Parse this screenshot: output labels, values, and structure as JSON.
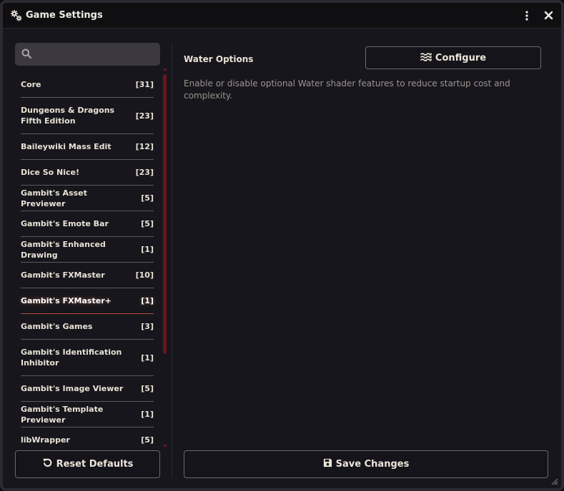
{
  "window": {
    "title": "Game Settings",
    "icons": {
      "title": "gears-icon",
      "menu": "kebab-menu-icon",
      "close": "close-icon"
    }
  },
  "sidebar": {
    "search": {
      "value": "",
      "placeholder": ""
    },
    "categories": [
      {
        "label": "Core",
        "count": "[31]"
      },
      {
        "label": "Dungeons & Dragons Fifth Edition",
        "count": "[23]"
      },
      {
        "label": "Baileywiki Mass Edit",
        "count": "[12]"
      },
      {
        "label": "Dice So Nice!",
        "count": "[23]"
      },
      {
        "label": "Gambit's Asset Previewer",
        "count": "[5]"
      },
      {
        "label": "Gambit's Emote Bar",
        "count": "[5]"
      },
      {
        "label": "Gambit's Enhanced Drawing",
        "count": "[1]"
      },
      {
        "label": "Gambit's FXMaster",
        "count": "[10]"
      },
      {
        "label": "Gambit's FXMaster+",
        "count": "[1]",
        "active": true
      },
      {
        "label": "Gambit's Games",
        "count": "[3]"
      },
      {
        "label": "Gambit's Identification Inhibitor",
        "count": "[1]"
      },
      {
        "label": "Gambit's Image Viewer",
        "count": "[5]"
      },
      {
        "label": "Gambit's Template Previewer",
        "count": "[1]"
      },
      {
        "label": "libWrapper",
        "count": "[5]"
      }
    ],
    "reset_label": "Reset Defaults"
  },
  "main": {
    "setting_name": "Water Options",
    "configure_label": "Configure",
    "setting_description": "Enable or disable optional Water shader features to reduce startup cost and complexity.",
    "save_label": "Save Changes"
  },
  "colors": {
    "accent": "#6b1420",
    "active_underline": "#b84a3a",
    "background": "#17161c"
  }
}
